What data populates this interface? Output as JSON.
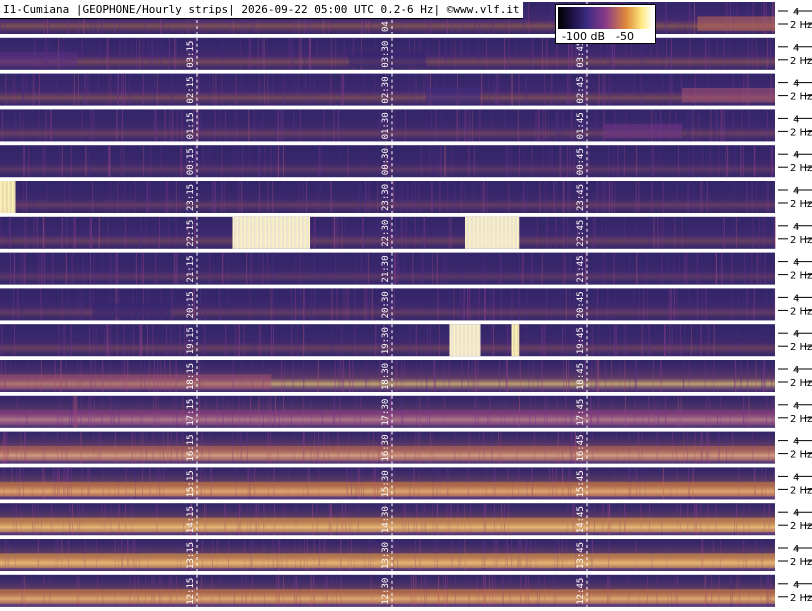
{
  "title": "I1-Cumiana |GEOPHONE/Hourly strips| 2026-09-22 05:00 UTC 0.2-6 Hz| ©www.vlf.it",
  "colorbar": {
    "min_label": "-100 dB",
    "mid_label": "-50"
  },
  "chart_data": {
    "type": "heatmap",
    "title": "I1-Cumiana |GEOPHONE/Hourly strips| 2026-09-22 05:00 UTC 0.2-6 Hz| ©www.vlf.it",
    "colorscale": [
      "#000000",
      "#1a1040",
      "#3a2a80",
      "#8a3a8a",
      "#e08a3a",
      "#ffe880",
      "#ffffff"
    ],
    "color_range_db": [
      -100,
      -40
    ],
    "freq_range_hz": [
      0.2,
      6
    ],
    "freq_tick_labels": [
      "4",
      "2 Hz"
    ],
    "strips": [
      {
        "marks": [
          "04:15",
          "04:30",
          "04:45"
        ],
        "shown": [
          false,
          true,
          false
        ],
        "intensity": 0.3,
        "bands": [
          [
            0.9,
            1.0,
            0.6
          ]
        ]
      },
      {
        "marks": [
          "03:15",
          "03:30",
          "03:45"
        ],
        "shown": [
          true,
          true,
          true
        ],
        "intensity": 0.28,
        "bands": [
          [
            0.0,
            0.1,
            0.4
          ],
          [
            0.45,
            0.55,
            0.3
          ]
        ]
      },
      {
        "marks": [
          "02:15",
          "02:30",
          "02:45"
        ],
        "shown": [
          true,
          true,
          true
        ],
        "intensity": 0.28,
        "bands": [
          [
            0.55,
            0.62,
            0.35
          ],
          [
            0.88,
            1.0,
            0.55
          ]
        ]
      },
      {
        "marks": [
          "01:15",
          "01:30",
          "01:45"
        ],
        "shown": [
          true,
          true,
          true
        ],
        "intensity": 0.25,
        "bands": [
          [
            0.78,
            0.88,
            0.45
          ]
        ]
      },
      {
        "marks": [
          "00:15",
          "00:30",
          "00:45"
        ],
        "shown": [
          true,
          true,
          true
        ],
        "intensity": 0.22,
        "bands": []
      },
      {
        "marks": [
          "23:15",
          "23:30",
          "23:45"
        ],
        "shown": [
          true,
          true,
          true
        ],
        "intensity": 0.24,
        "bands": [
          [
            0.0,
            0.02,
            0.9
          ]
        ]
      },
      {
        "marks": [
          "22:15",
          "22:30",
          "22:45"
        ],
        "shown": [
          true,
          true,
          true
        ],
        "intensity": 0.25,
        "bands": [
          [
            0.3,
            0.4,
            0.95
          ],
          [
            0.6,
            0.67,
            0.95
          ]
        ]
      },
      {
        "marks": [
          "21:15",
          "21:30",
          "21:45"
        ],
        "shown": [
          true,
          true,
          true
        ],
        "intensity": 0.22,
        "bands": []
      },
      {
        "marks": [
          "20:15",
          "20:30",
          "20:45"
        ],
        "shown": [
          true,
          true,
          true
        ],
        "intensity": 0.24,
        "bands": [
          [
            0.12,
            0.22,
            0.3
          ]
        ]
      },
      {
        "marks": [
          "19:15",
          "19:30",
          "19:45"
        ],
        "shown": [
          true,
          true,
          true
        ],
        "intensity": 0.25,
        "bands": [
          [
            0.58,
            0.62,
            0.95
          ],
          [
            0.66,
            0.67,
            0.9
          ]
        ]
      },
      {
        "marks": [
          "18:15",
          "18:30",
          "18:45"
        ],
        "shown": [
          true,
          true,
          true
        ],
        "intensity": 0.45,
        "bands": [
          [
            0.0,
            0.35,
            0.55
          ]
        ]
      },
      {
        "marks": [
          "17:15",
          "17:30",
          "17:45"
        ],
        "shown": [
          true,
          true,
          true
        ],
        "intensity": 0.5,
        "bands": [
          [
            0.0,
            1.0,
            0.5
          ]
        ]
      },
      {
        "marks": [
          "16:15",
          "16:30",
          "16:45"
        ],
        "shown": [
          true,
          true,
          true
        ],
        "intensity": 0.55,
        "bands": [
          [
            0.0,
            1.0,
            0.6
          ]
        ]
      },
      {
        "marks": [
          "15:15",
          "15:30",
          "15:45"
        ],
        "shown": [
          true,
          true,
          true
        ],
        "intensity": 0.55,
        "bands": [
          [
            0.0,
            1.0,
            0.65
          ]
        ]
      },
      {
        "marks": [
          "14:15",
          "14:30",
          "14:45"
        ],
        "shown": [
          true,
          true,
          true
        ],
        "intensity": 0.55,
        "bands": [
          [
            0.0,
            1.0,
            0.7
          ]
        ]
      },
      {
        "marks": [
          "13:15",
          "13:30",
          "13:45"
        ],
        "shown": [
          true,
          true,
          true
        ],
        "intensity": 0.55,
        "bands": [
          [
            0.0,
            1.0,
            0.7
          ]
        ]
      },
      {
        "marks": [
          "12:15",
          "12:30",
          "12:45"
        ],
        "shown": [
          true,
          true,
          true
        ],
        "intensity": 0.55,
        "bands": [
          [
            0.0,
            1.0,
            0.65
          ]
        ]
      }
    ]
  }
}
